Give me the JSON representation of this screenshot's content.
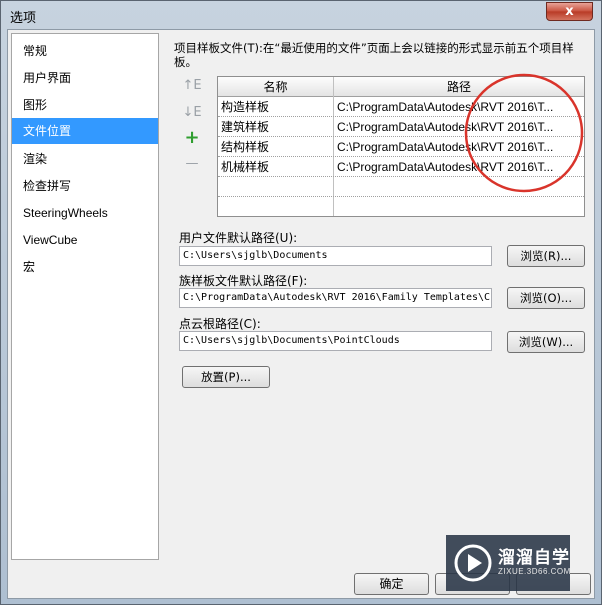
{
  "window": {
    "title": "选项",
    "close_glyph": "x"
  },
  "sidebar": {
    "items": [
      {
        "label": "常规"
      },
      {
        "label": "用户界面"
      },
      {
        "label": "图形"
      },
      {
        "label": "文件位置",
        "selected": true
      },
      {
        "label": "渲染"
      },
      {
        "label": "检查拼写"
      },
      {
        "label": "SteeringWheels"
      },
      {
        "label": "ViewCube"
      },
      {
        "label": "宏"
      }
    ]
  },
  "templates": {
    "description": "项目样板文件(T):在“最近使用的文件”页面上会以链接的形式显示前五个项目样板。",
    "columns": {
      "name": "名称",
      "path": "路径"
    },
    "rows": [
      {
        "name": "构造样板",
        "path": "C:\\ProgramData\\Autodesk\\RVT 2016\\T..."
      },
      {
        "name": "建筑样板",
        "path": "C:\\ProgramData\\Autodesk\\RVT 2016\\T..."
      },
      {
        "name": "结构样板",
        "path": "C:\\ProgramData\\Autodesk\\RVT 2016\\T..."
      },
      {
        "name": "机械样板",
        "path": "C:\\ProgramData\\Autodesk\\RVT 2016\\T..."
      }
    ],
    "tools": {
      "move_up": "↑E",
      "move_down": "↓E",
      "add": "+",
      "remove": "—"
    },
    "annotation_color": "#d9342b"
  },
  "user_path": {
    "label": "用户文件默认路径(U):",
    "value": "C:\\Users\\sjglb\\Documents",
    "browse": "浏览(R)..."
  },
  "family_path": {
    "label": "族样板文件默认路径(F):",
    "value": "C:\\ProgramData\\Autodesk\\RVT 2016\\Family Templates\\C",
    "browse": "浏览(O)..."
  },
  "cloud_path": {
    "label": "点云根路径(C):",
    "value": "C:\\Users\\sjglb\\Documents\\PointClouds",
    "browse": "浏览(W)..."
  },
  "places_button": "放置(P)...",
  "footer": {
    "ok": "确定"
  },
  "watermark": {
    "main": "溜溜自学",
    "sub": "ZIXUE.3D66.COM"
  },
  "colors": {
    "selection": "#3399ff",
    "titlebar": "#bccbdb",
    "close": "#c8503c"
  }
}
